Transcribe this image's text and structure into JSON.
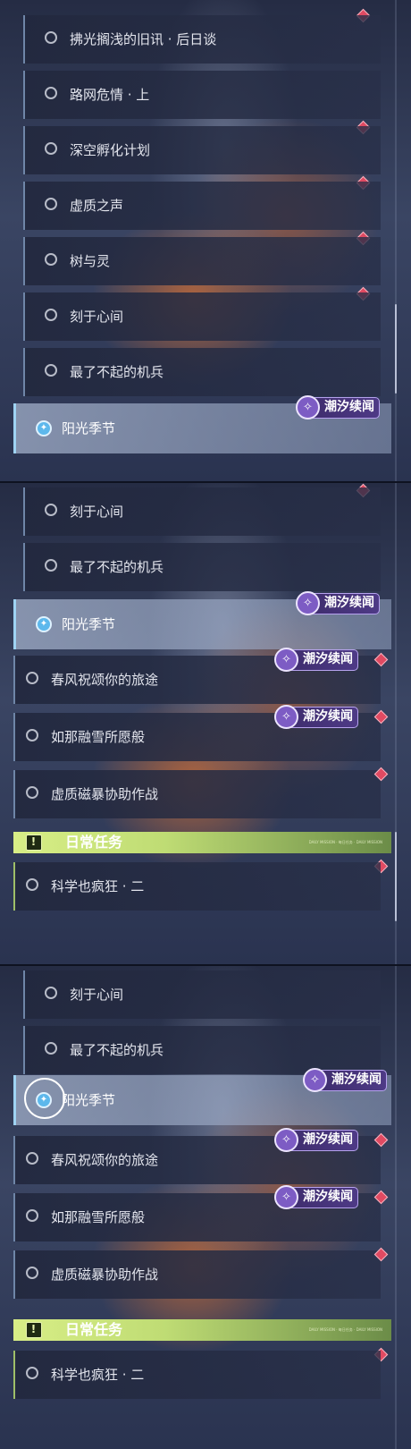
{
  "quest_badge": "潮汐续闻",
  "daily_header": "日常任务",
  "daily_header_decoration": "DAILY MISSION · 每日任务 · DAILY MISSION",
  "panel1": {
    "rows": [
      "拂光搁浅的旧讯 · 后日谈",
      "路网危情 · 上",
      "深空孵化计划",
      "虚质之声",
      "树与灵",
      "刻于心间",
      "最了不起的机兵"
    ],
    "selected": "阳光季节"
  },
  "panel2": {
    "rows_before": [
      "刻于心间",
      "最了不起的机兵"
    ],
    "selected": "阳光季节",
    "rows_after": [
      "春风祝颂你的旅途",
      "如那融雪所愿般",
      "虚质磁暴协助作战"
    ],
    "daily_rows": [
      "科学也疯狂 · 二"
    ]
  },
  "panel3": {
    "rows_before": [
      "刻于心间",
      "最了不起的机兵"
    ],
    "selected": "阳光季节",
    "rows_after": [
      "春风祝颂你的旅途",
      "如那融雪所愿般",
      "虚质磁暴协助作战"
    ],
    "daily_rows": [
      "科学也疯狂 · 二"
    ]
  },
  "colors": {
    "selected_accent": "#5db8ec",
    "badge_purple": "#4e3a86",
    "daily_green": "#cde67e",
    "new_marker_red": "#e04a62"
  },
  "icons": [
    "circle-icon",
    "compass-star-icon",
    "badge-star-icon",
    "alert-icon",
    "red-diamond-icon"
  ]
}
